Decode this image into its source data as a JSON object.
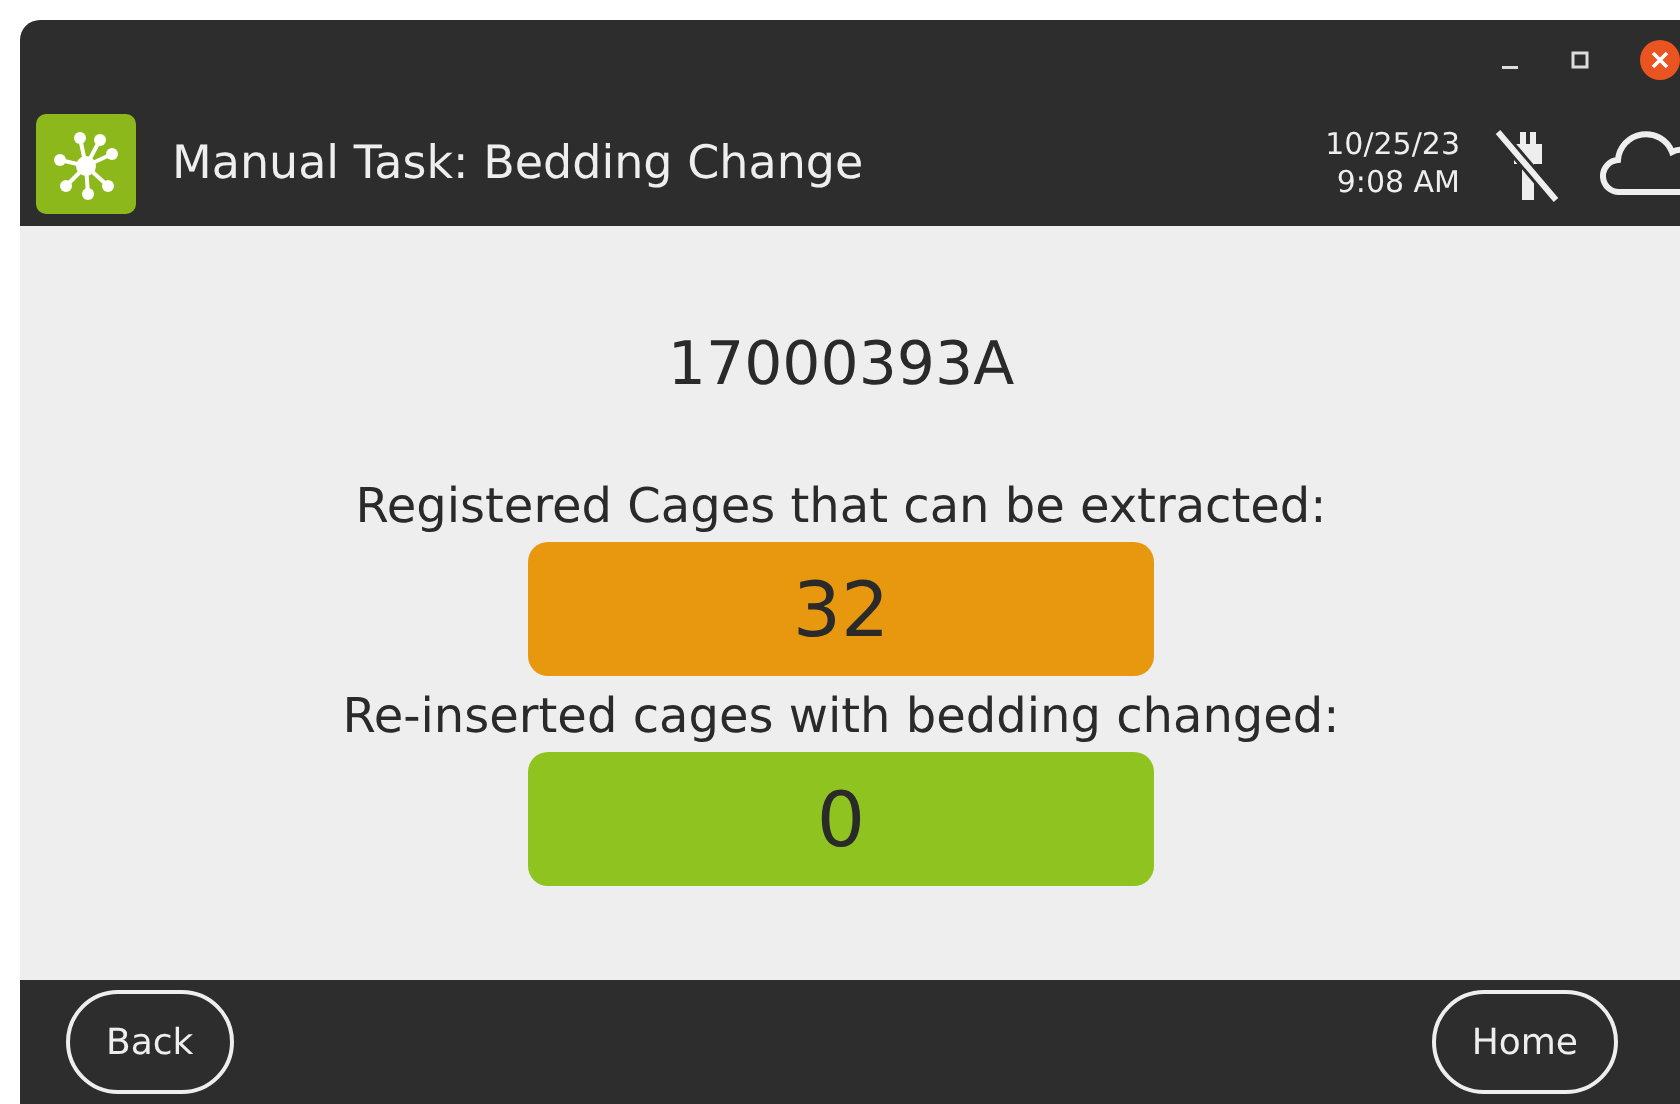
{
  "window": {
    "title": "Manual Task: Bedding Change",
    "date": "10/25/23",
    "time": "9:08 AM"
  },
  "status": {
    "wired": false
  },
  "id": "17000393A",
  "counters": [
    {
      "label": "Registered Cages that can be extracted:",
      "value": "32",
      "color": "#e8980f"
    },
    {
      "label": "Re-inserted cages with bedding changed:",
      "value": "0",
      "color": "#8fc31f"
    }
  ],
  "buttons": [
    "Back",
    "Home"
  ]
}
